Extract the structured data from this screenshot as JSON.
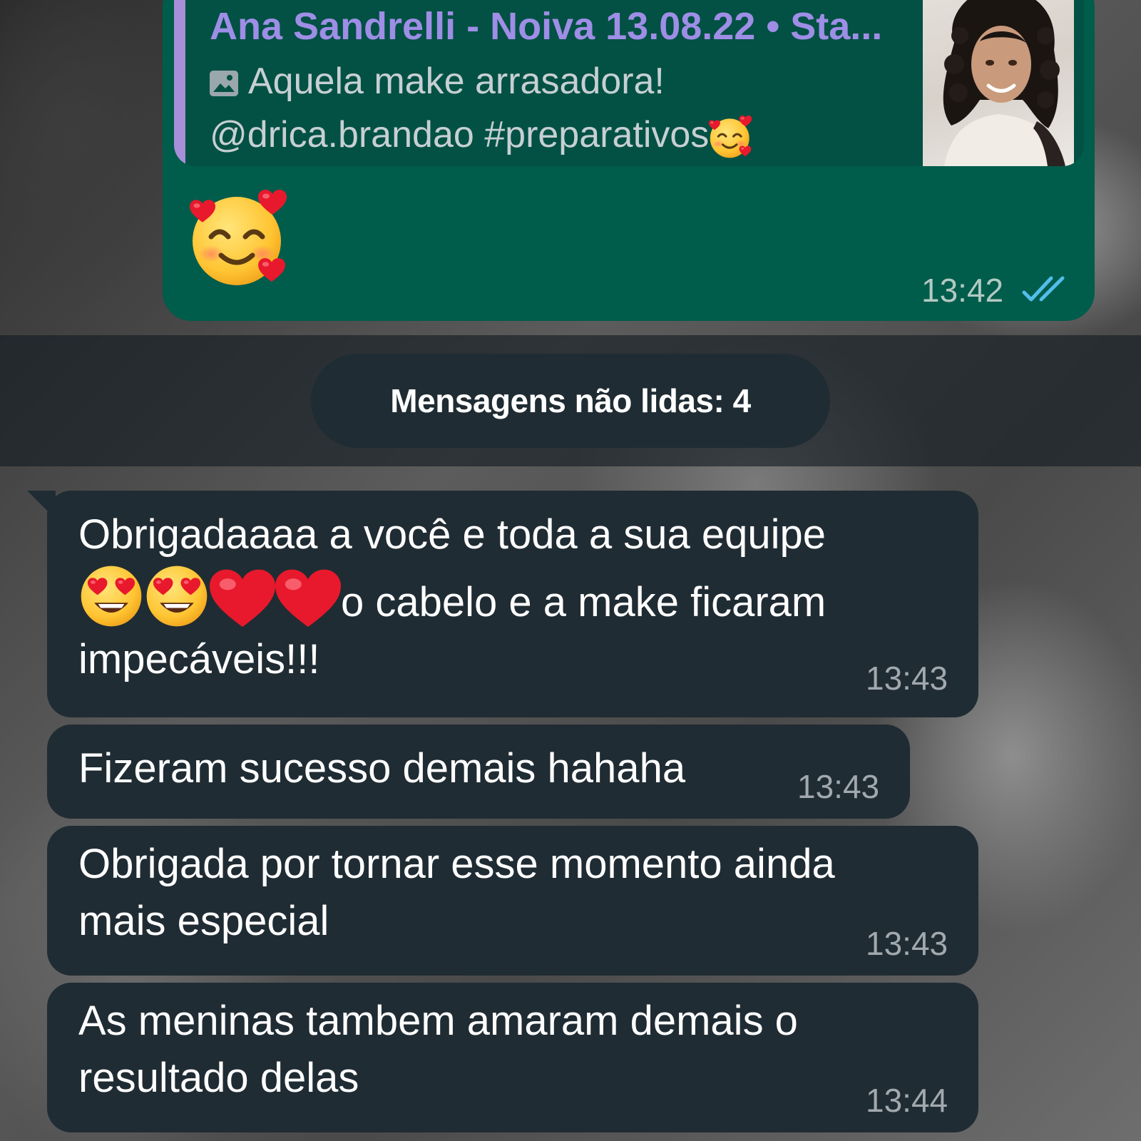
{
  "reply_preview": {
    "author": "Ana Sandrelli - Noiva 13.08.22 • Sta...",
    "line1": "Aquela make arrasadora!",
    "line2": "@drica.brandao #preparativos",
    "icon": "image-icon",
    "thumbnail": "profile-photo"
  },
  "outgoing": {
    "emoji": "smiling-face-with-hearts",
    "time": "13:42",
    "status": "read",
    "ticks_color": "#53bdeb"
  },
  "unread_divider": {
    "label": "Mensagens não lidas: 4"
  },
  "messages": [
    {
      "part1": "Obrigadaaaa a você e toda a sua equipe",
      "emojis": [
        "heart-eyes",
        "heart-eyes",
        "red-heart",
        "red-heart"
      ],
      "part2": "o cabelo e a make ficaram",
      "part3": "impecáveis!!!",
      "time": "13:43"
    },
    {
      "text": "Fizeram sucesso demais hahaha",
      "time": "13:43"
    },
    {
      "line1": "Obrigada por tornar esse momento ainda",
      "line2": "mais especial",
      "time": "13:43"
    },
    {
      "line1": "As meninas tambem amaram demais o",
      "line2": "resultado delas",
      "time": "13:44"
    }
  ],
  "colors": {
    "outgoing_bubble": "#005c4b",
    "incoming_bubble": "#202c33",
    "reply_accent": "#a78fd9",
    "author_name": "#9e8ee6"
  }
}
